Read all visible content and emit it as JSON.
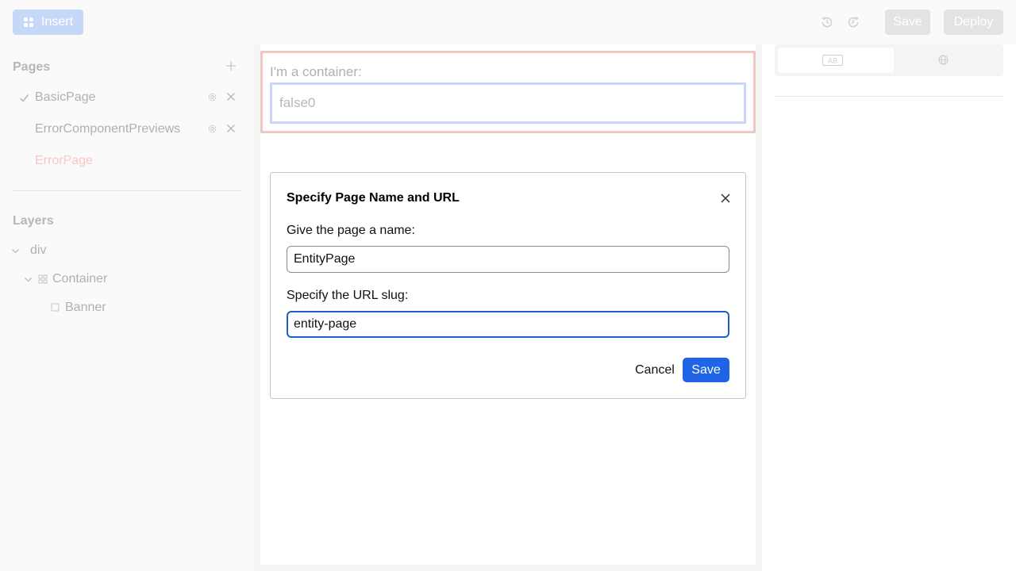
{
  "toolbar": {
    "insert_label": "Insert",
    "save_label": "Save",
    "deploy_label": "Deploy"
  },
  "sidebar": {
    "pages_title": "Pages",
    "pages": [
      {
        "label": "BasicPage",
        "selected": true
      },
      {
        "label": "ErrorComponentPreviews",
        "selected": false
      },
      {
        "label": "ErrorPage",
        "selected": false,
        "error": true
      }
    ],
    "layers_title": "Layers",
    "layers": [
      {
        "label": "div"
      },
      {
        "label": "Container"
      },
      {
        "label": "Banner"
      }
    ]
  },
  "canvas": {
    "container_label": "I'm a container:",
    "banner_text": "false0"
  },
  "dialog": {
    "title": "Specify Page Name and URL",
    "name_label": "Give the page a name:",
    "name_value": "EntityPage",
    "slug_label": "Specify the URL slug:",
    "slug_value": "entity-page",
    "cancel_label": "Cancel",
    "save_label": "Save"
  },
  "right_panel": {
    "tabs": [
      {
        "icon": "text-style-icon",
        "active": true
      },
      {
        "icon": "globe-icon",
        "active": false
      }
    ],
    "tab_badge": "AB"
  },
  "colors": {
    "accent": "#1f63e6",
    "error": "#f4c7c7",
    "error_text": "#f8c9c4"
  }
}
